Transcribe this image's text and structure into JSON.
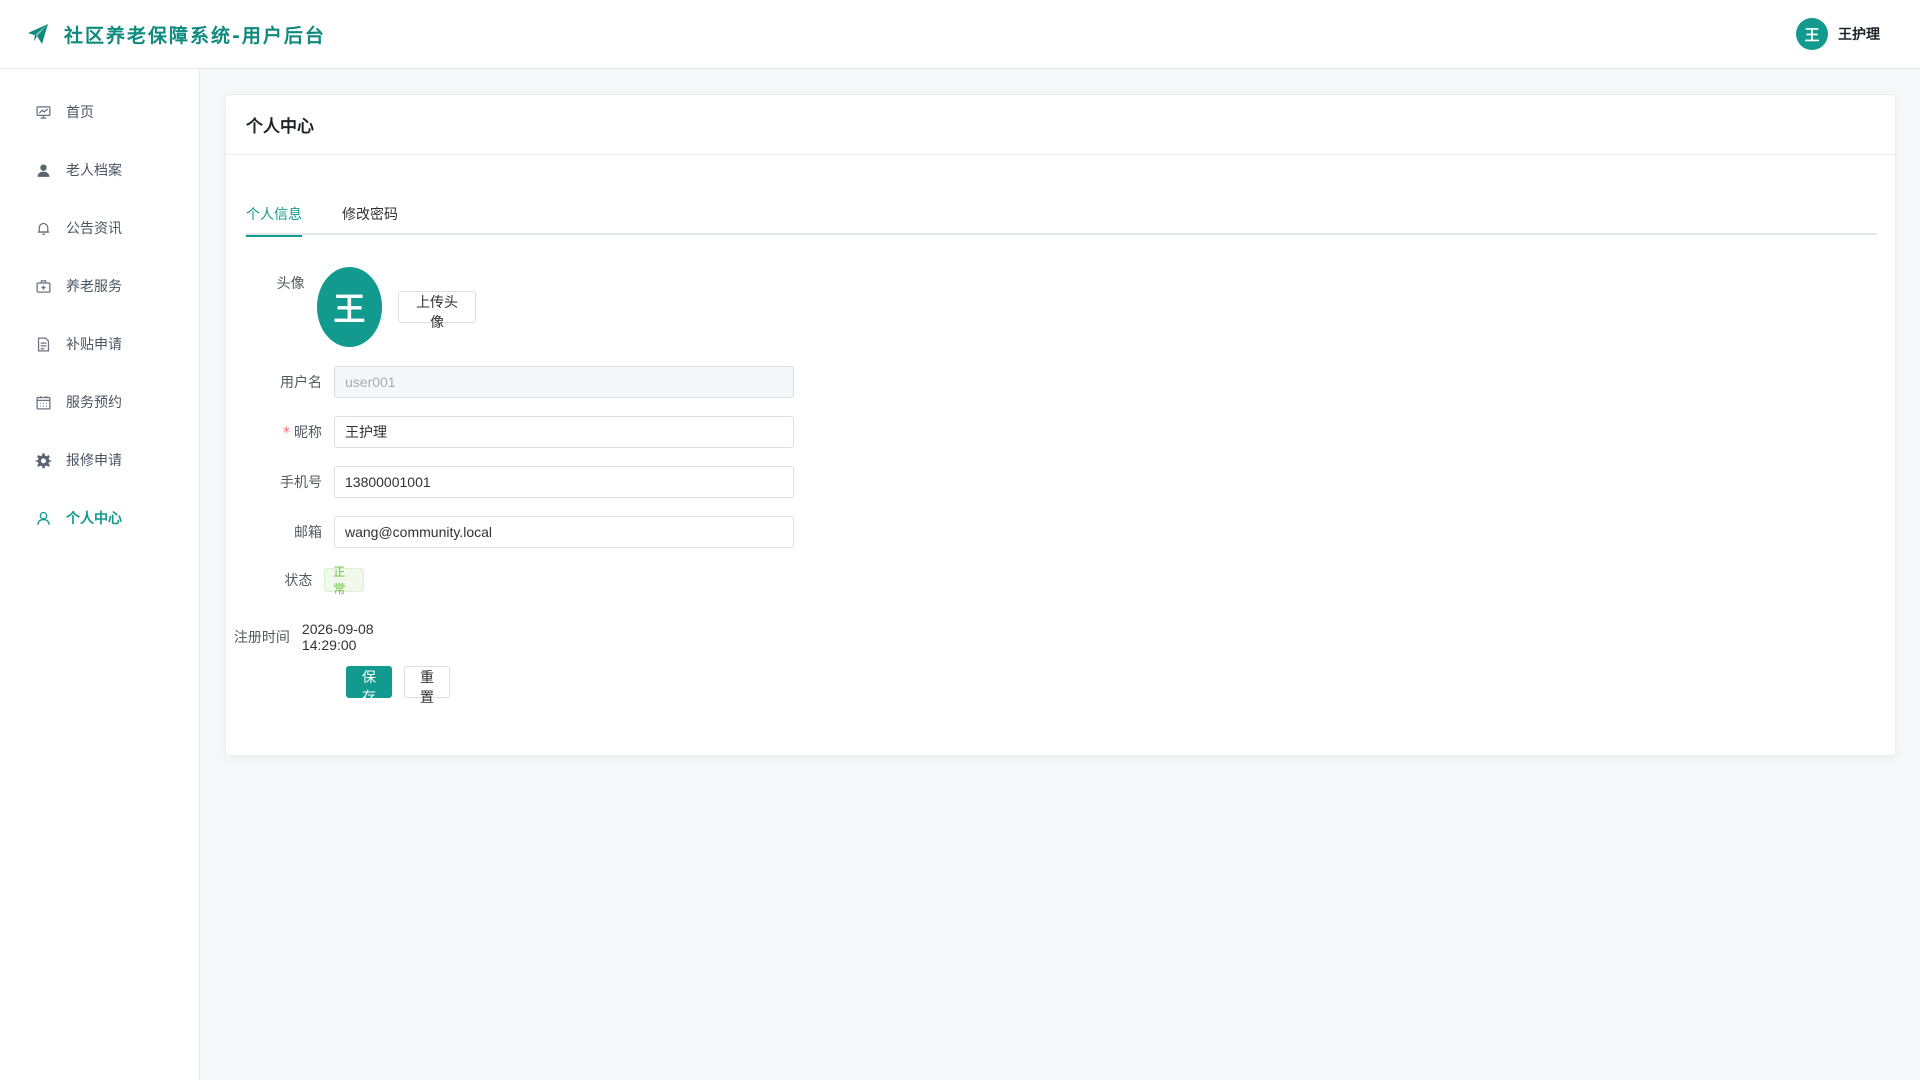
{
  "header": {
    "title": "社区养老保障系统-用户后台",
    "brand_icon": "paper-plane-icon",
    "user_avatar_text": "王",
    "user_name": "王护理"
  },
  "sidebar": {
    "items": [
      {
        "label": "首页",
        "icon": "chart-board-icon",
        "active": false
      },
      {
        "label": "老人档案",
        "icon": "user-filled-icon",
        "active": false
      },
      {
        "label": "公告资讯",
        "icon": "bell-icon",
        "active": false
      },
      {
        "label": "养老服务",
        "icon": "first-aid-kit-icon",
        "active": false
      },
      {
        "label": "补贴申请",
        "icon": "document-icon",
        "active": false
      },
      {
        "label": "服务预约",
        "icon": "calendar-icon",
        "active": false
      },
      {
        "label": "报修申请",
        "icon": "gear-icon",
        "active": false
      },
      {
        "label": "个人中心",
        "icon": "user-outline-icon",
        "active": true
      }
    ]
  },
  "page": {
    "title": "个人中心",
    "tabs": [
      {
        "label": "个人信息",
        "active": true
      },
      {
        "label": "修改密码",
        "active": false
      }
    ]
  },
  "form": {
    "avatar_label": "头像",
    "avatar_text": "王",
    "upload_label": "上传头像",
    "username_label": "用户名",
    "username_value": "user001",
    "nickname_label": "昵称",
    "nickname_required": "*",
    "nickname_value": "王护理",
    "phone_label": "手机号",
    "phone_value": "13800001001",
    "email_label": "邮箱",
    "email_value": "wang@community.local",
    "status_label": "状态",
    "status_value": "正常",
    "register_label": "注册时间",
    "register_value": "2026-09-08 14:29:00",
    "save_label": "保存修改",
    "reset_label": "重置"
  },
  "colors": {
    "primary": "#119a8d",
    "status_success": "#67c23a",
    "required": "#f56c6c"
  }
}
